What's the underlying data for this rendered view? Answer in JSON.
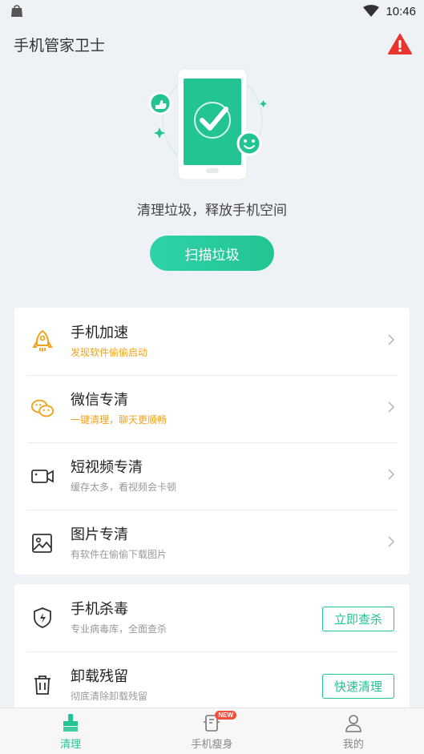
{
  "status_bar": {
    "time": "10:46"
  },
  "header": {
    "title": "手机管家卫士"
  },
  "hero": {
    "tagline": "清理垃圾，释放手机空间",
    "scan_button": "扫描垃圾"
  },
  "features": [
    {
      "title": "手机加速",
      "subtitle": "发现软件偷偷启动",
      "icon": "rocket-icon",
      "subtitle_color": "#f0a21e"
    },
    {
      "title": "微信专清",
      "subtitle": "一键清理，聊天更顺畅",
      "icon": "wechat-icon",
      "subtitle_color": "#f0a21e"
    },
    {
      "title": "短视频专清",
      "subtitle": "缓存太多，看视频会卡顿",
      "icon": "video-camera-icon"
    },
    {
      "title": "图片专清",
      "subtitle": "有软件在偷偷下载图片",
      "icon": "image-icon"
    }
  ],
  "tools": [
    {
      "title": "手机杀毒",
      "subtitle": "专业病毒库，全面查杀",
      "icon": "shield-icon",
      "button": "立即查杀"
    },
    {
      "title": "卸载残留",
      "subtitle": "彻底清除卸载残留",
      "icon": "trash-icon",
      "button": "快速清理"
    }
  ],
  "bottom_nav": {
    "items": [
      {
        "label": "清理",
        "icon": "broom-icon",
        "active": true
      },
      {
        "label": "手机瘦身",
        "icon": "phone-slim-icon",
        "badge": "NEW"
      },
      {
        "label": "我的",
        "icon": "user-icon"
      }
    ]
  },
  "colors": {
    "accent": "#22c493",
    "warning": "#e8362f",
    "orange": "#f0a21e"
  }
}
